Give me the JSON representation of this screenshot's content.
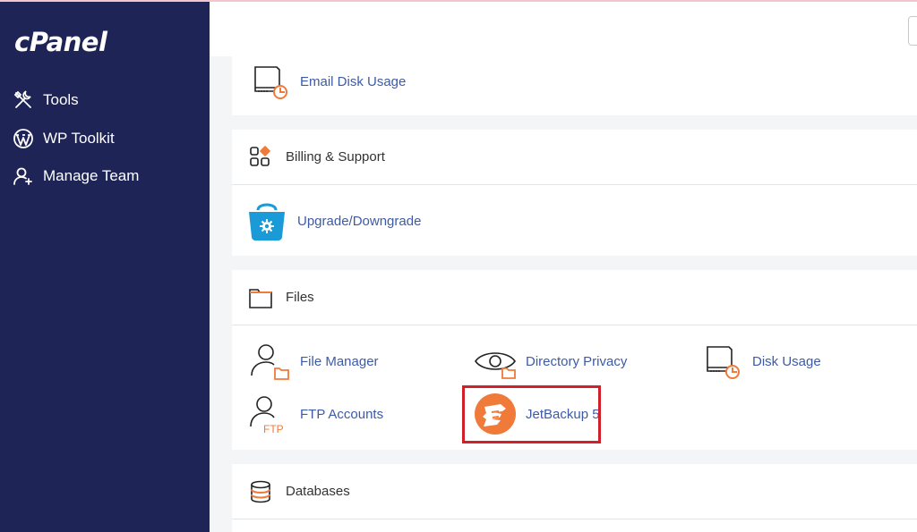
{
  "brand": {
    "logo_text": "cPanel"
  },
  "sidebar": {
    "items": [
      {
        "label": "Tools",
        "icon": "tools-icon"
      },
      {
        "label": "WP Toolkit",
        "icon": "wordpress-icon"
      },
      {
        "label": "Manage Team",
        "icon": "manage-team-icon"
      }
    ]
  },
  "sections": {
    "email": {
      "items": [
        {
          "label": "Email Disk Usage",
          "icon": "email-disk-usage-icon"
        }
      ]
    },
    "billing": {
      "title": "Billing & Support",
      "icon": "billing-support-icon",
      "items": [
        {
          "label": "Upgrade/Downgrade",
          "icon": "upgrade-downgrade-icon"
        }
      ]
    },
    "files": {
      "title": "Files",
      "icon": "folder-icon",
      "items": [
        {
          "label": "File Manager",
          "icon": "file-manager-icon"
        },
        {
          "label": "Directory Privacy",
          "icon": "directory-privacy-icon"
        },
        {
          "label": "Disk Usage",
          "icon": "disk-usage-icon"
        },
        {
          "label": "FTP Accounts",
          "icon": "ftp-accounts-icon"
        },
        {
          "label": "JetBackup 5",
          "icon": "jetbackup-icon"
        }
      ]
    },
    "databases": {
      "title": "Databases",
      "icon": "databases-icon"
    }
  },
  "labels": {
    "ftp_icon_text": "FTP"
  },
  "colors": {
    "sidebar_bg": "#1f2456",
    "link_text": "#3d5ba5",
    "accent_orange": "#f07a3a",
    "highlight_red": "#d0202a",
    "upgrade_blue": "#1a9ad6"
  }
}
